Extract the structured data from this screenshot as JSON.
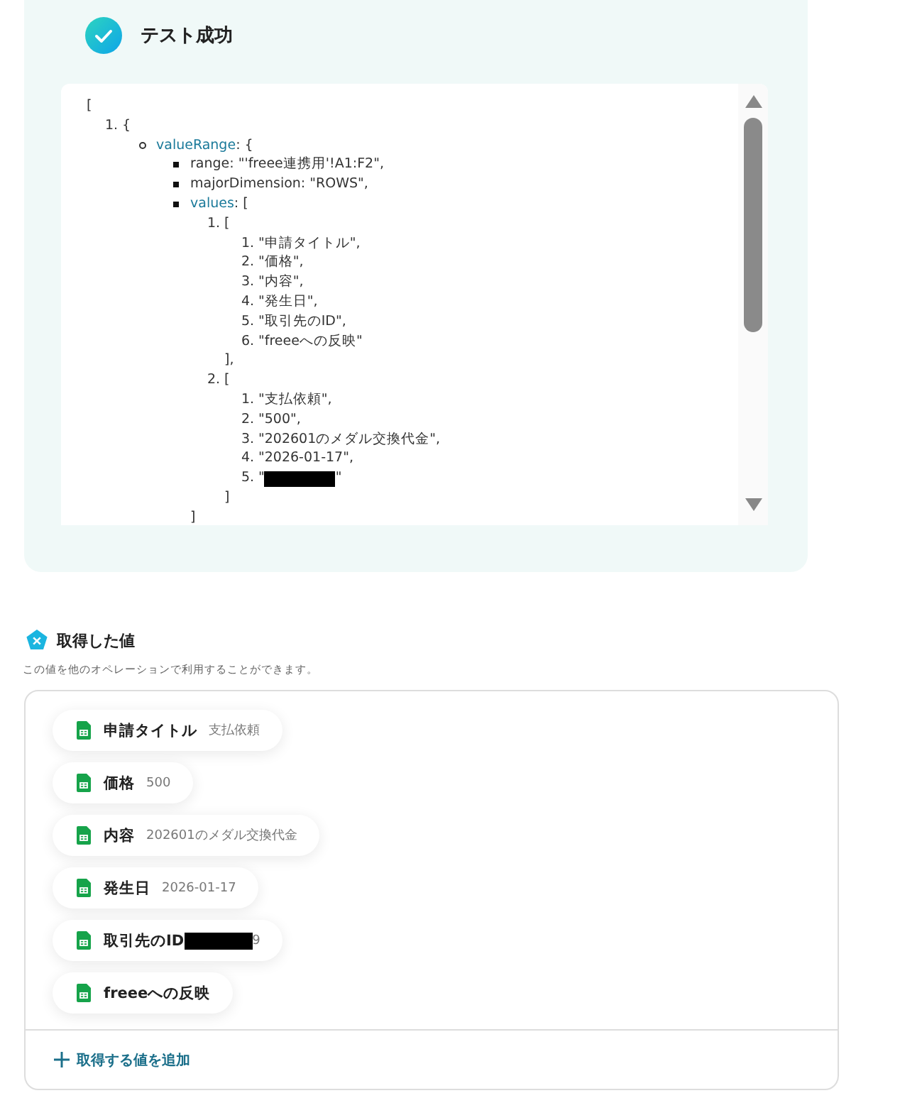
{
  "test_result": {
    "title": "テスト成功",
    "code": {
      "text": "[",
      "children": [
        {
          "marker": "1.",
          "text": "{",
          "children": [
            {
              "kind": "circle",
              "key": "valueRange",
              "text": ": {",
              "children": [
                {
                  "kind": "square",
                  "text": "range: \"'freee連携用'!A1:F2\","
                },
                {
                  "kind": "square",
                  "text": "majorDimension: \"ROWS\","
                },
                {
                  "kind": "square",
                  "key": "values",
                  "text": ": [",
                  "close": "]",
                  "children": [
                    {
                      "marker": "1.",
                      "text": "[",
                      "close": "],",
                      "children": [
                        {
                          "marker": "1.",
                          "text": "\"申請タイトル\","
                        },
                        {
                          "marker": "2.",
                          "text": "\"価格\","
                        },
                        {
                          "marker": "3.",
                          "text": "\"内容\","
                        },
                        {
                          "marker": "4.",
                          "text": "\"発生日\","
                        },
                        {
                          "marker": "5.",
                          "text": "\"取引先のID\","
                        },
                        {
                          "marker": "6.",
                          "text": "\"freeeへの反映\""
                        }
                      ]
                    },
                    {
                      "marker": "2.",
                      "text": "[",
                      "close": "]",
                      "children": [
                        {
                          "marker": "1.",
                          "text": "\"支払依頼\","
                        },
                        {
                          "marker": "2.",
                          "text": "\"500\","
                        },
                        {
                          "marker": "3.",
                          "text": "\"202601のメダル交換代金\","
                        },
                        {
                          "marker": "4.",
                          "text": "\"2026-01-17\","
                        },
                        {
                          "marker": "5.",
                          "text": "\"",
                          "redacted": true,
                          "text_after": "\""
                        }
                      ]
                    }
                  ]
                }
              ]
            }
          ]
        }
      ]
    }
  },
  "values_section": {
    "title": "取得した値",
    "description": "この値を他のオペレーションで利用することができます。",
    "chips": [
      {
        "label": "申請タイトル",
        "value": "支払依頼",
        "redacted": false
      },
      {
        "label": "価格",
        "value": "500",
        "redacted": false
      },
      {
        "label": "内容",
        "value": "202601のメダル交換代金",
        "redacted": false
      },
      {
        "label": "発生日",
        "value": "2026-01-17",
        "redacted": false
      },
      {
        "label": "取引先のID",
        "value": "9",
        "redacted": true
      },
      {
        "label": "freeeへの反映",
        "redacted": false
      }
    ],
    "add_button": "取得する値を追加"
  }
}
